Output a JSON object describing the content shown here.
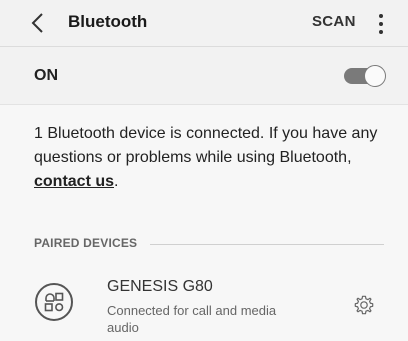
{
  "header": {
    "title": "Bluetooth",
    "scan_label": "SCAN",
    "back_icon": "back-arrow-icon",
    "more_icon": "more-vertical-icon"
  },
  "toggle_row": {
    "label": "ON",
    "state": true
  },
  "info": {
    "text_before": "1 Bluetooth device is connected. If you have any questions or problems while using Bluetooth, ",
    "link": "contact us",
    "text_after": "."
  },
  "paired_section": {
    "label": "PAIRED DEVICES",
    "devices": [
      {
        "name": "GENESIS G80",
        "status": "Connected for call and media audio",
        "icon": "car-device-icon",
        "settings_icon": "gear-icon"
      }
    ]
  },
  "colors": {
    "background": "#f7f7f7",
    "header_bg": "#f2f2f2",
    "toggle_track": "#7a7a7a"
  }
}
